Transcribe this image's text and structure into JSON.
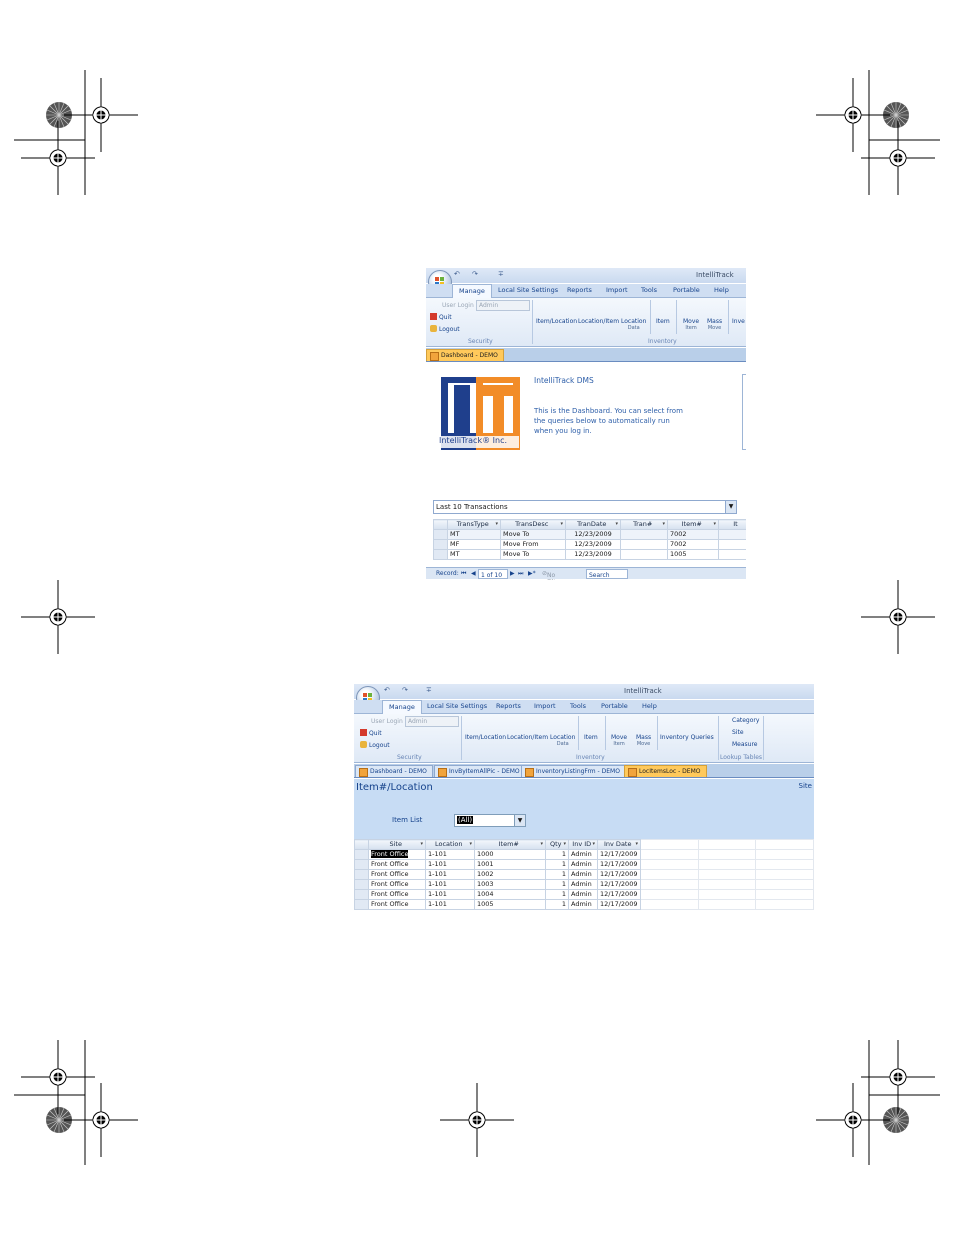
{
  "colors": {
    "ribbon_blue": "#15428b",
    "ribbon_bg": "#dfe9f6",
    "active_doc_tab": "#ffc95b",
    "form_bg": "#c7dcf4",
    "logo_blue": "#1f3f8c",
    "logo_orange": "#f28c28"
  },
  "screenshot1": {
    "app_title": "IntelliTrack",
    "quick_access": {
      "undo": "↶",
      "redo": "↷",
      "customize": "∓"
    },
    "ribbon_tabs": [
      "Manage",
      "Local Site Settings",
      "Reports",
      "Import",
      "Tools",
      "Portable",
      "Help"
    ],
    "security": {
      "user_login_label": "User Login",
      "user_login_value": "Admin",
      "quit_label": "Quit",
      "logout_label": "Logout",
      "group_label": "Security"
    },
    "inventory": {
      "items": [
        {
          "top": "Item/Location",
          "bottom": ""
        },
        {
          "top": "Location/Item",
          "bottom": ""
        },
        {
          "top": "Location",
          "bottom": "Data"
        },
        {
          "top": "Item",
          "bottom": ""
        },
        {
          "top": "Move",
          "bottom": "Item"
        },
        {
          "top": "Mass",
          "bottom": "Move"
        },
        {
          "top": "Inve",
          "bottom": ""
        }
      ],
      "group_label": "Inventory"
    },
    "doc_tab": "Dashboard - DEMO",
    "logo_caption": "IntelliTrack® Inc.",
    "dashboard_title": "IntelliTrack DMS",
    "dashboard_text": "This is the Dashboard.  You can select from the queries below to automatically run when you log in.",
    "query_select": "Last 10 Transactions",
    "columns": [
      "TransType",
      "TransDesc",
      "TranDate",
      "Tran#",
      "Item#",
      "It"
    ],
    "rows": [
      [
        "MT",
        "Move To",
        "12/23/2009",
        "",
        "7002"
      ],
      [
        "MF",
        "Move From",
        "12/23/2009",
        "",
        "7002"
      ],
      [
        "MT",
        "Move To",
        "12/23/2009",
        "",
        "1005"
      ]
    ],
    "nav": {
      "record_label": "Record:",
      "position": "1 of 10",
      "filter": "No Filter",
      "search": "Search"
    }
  },
  "screenshot2": {
    "app_title": "IntelliTrack",
    "quick_access": {
      "undo": "↶",
      "redo": "↷",
      "customize": "∓"
    },
    "ribbon_tabs": [
      "Manage",
      "Local Site Settings",
      "Reports",
      "Import",
      "Tools",
      "Portable",
      "Help"
    ],
    "security": {
      "user_login_label": "User Login",
      "user_login_value": "Admin",
      "quit_label": "Quit",
      "logout_label": "Logout",
      "group_label": "Security"
    },
    "inventory": {
      "items": [
        {
          "top": "Item/Location",
          "bottom": ""
        },
        {
          "top": "Location/Item",
          "bottom": ""
        },
        {
          "top": "Location",
          "bottom": "Data"
        },
        {
          "top": "Item",
          "bottom": ""
        },
        {
          "top": "Move",
          "bottom": "Item"
        },
        {
          "top": "Mass",
          "bottom": "Move"
        },
        {
          "top": "Inventory Queries",
          "bottom": ""
        }
      ],
      "group_label": "Inventory"
    },
    "lookup": {
      "items": [
        "Category",
        "Site",
        "Measure"
      ],
      "group_label": "Lookup Tables"
    },
    "doc_tabs": [
      "Dashboard - DEMO",
      "InvByItemAllPic - DEMO",
      "InventoryListingFrm - DEMO",
      "LocItemsLoc - DEMO"
    ],
    "form_title": "Item#/Location",
    "form_corner_label": "Site",
    "item_list_label": "Item List",
    "item_list_value": "(All)",
    "columns": [
      "Site",
      "Location",
      "Item#",
      "Qty",
      "Inv ID",
      "Inv Date"
    ],
    "rows": [
      [
        "Front Office",
        "1-101",
        "1000",
        "1",
        "Admin",
        "12/17/2009"
      ],
      [
        "Front Office",
        "1-101",
        "1001",
        "1",
        "Admin",
        "12/17/2009"
      ],
      [
        "Front Office",
        "1-101",
        "1002",
        "1",
        "Admin",
        "12/17/2009"
      ],
      [
        "Front Office",
        "1-101",
        "1003",
        "1",
        "Admin",
        "12/17/2009"
      ],
      [
        "Front Office",
        "1-101",
        "1004",
        "1",
        "Admin",
        "12/17/2009"
      ],
      [
        "Front Office",
        "1-101",
        "1005",
        "1",
        "Admin",
        "12/17/2009"
      ]
    ]
  }
}
